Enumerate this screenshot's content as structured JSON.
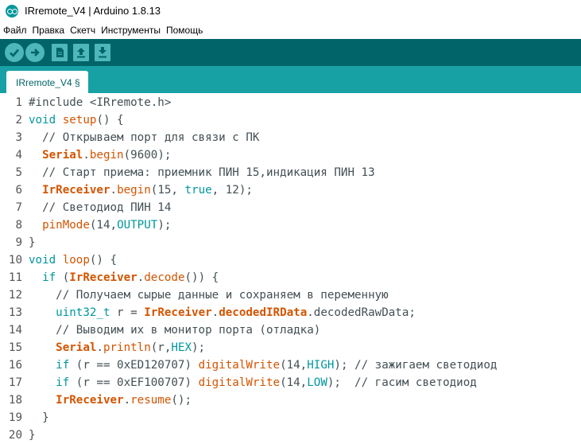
{
  "window": {
    "title": "IRremote_V4 | Arduino 1.8.13"
  },
  "menu": {
    "items": [
      "Файл",
      "Правка",
      "Скетч",
      "Инструменты",
      "Помощь"
    ]
  },
  "toolbar": {
    "buttons": [
      {
        "icon": "check-icon",
        "label": "verify"
      },
      {
        "icon": "arrow-right-icon",
        "label": "upload"
      },
      {
        "icon": "new-file-icon",
        "label": "new"
      },
      {
        "icon": "arrow-up-icon",
        "label": "open"
      },
      {
        "icon": "arrow-down-icon",
        "label": "save"
      }
    ]
  },
  "tabs": [
    {
      "label": "IRremote_V4 §"
    }
  ],
  "colors": {
    "toolbar": "#006468",
    "tabstrip": "#17a1a5",
    "keyword": "#00979c",
    "function": "#d35400",
    "text": "#434f54"
  },
  "editor": {
    "lines": [
      {
        "n": "1",
        "tokens": [
          {
            "t": "#include <IRremote.h>",
            "c": "plain"
          }
        ]
      },
      {
        "n": "2",
        "tokens": [
          {
            "t": "void",
            "c": "kw"
          },
          {
            "t": " ",
            "c": "plain"
          },
          {
            "t": "setup",
            "c": "fn"
          },
          {
            "t": "() {",
            "c": "plain"
          }
        ]
      },
      {
        "n": "3",
        "tokens": [
          {
            "t": "  // Открываем порт для связи с ПК",
            "c": "comment"
          }
        ]
      },
      {
        "n": "4",
        "tokens": [
          {
            "t": "  ",
            "c": "plain"
          },
          {
            "t": "Serial",
            "c": "bold"
          },
          {
            "t": ".",
            "c": "plain"
          },
          {
            "t": "begin",
            "c": "fn"
          },
          {
            "t": "(9600);",
            "c": "plain"
          }
        ]
      },
      {
        "n": "5",
        "tokens": [
          {
            "t": "  // Старт приема: приемник ПИН 15,индикация ПИН 13",
            "c": "comment"
          }
        ]
      },
      {
        "n": "6",
        "tokens": [
          {
            "t": "  ",
            "c": "plain"
          },
          {
            "t": "IrReceiver",
            "c": "bold"
          },
          {
            "t": ".",
            "c": "plain"
          },
          {
            "t": "begin",
            "c": "fn"
          },
          {
            "t": "(15, ",
            "c": "plain"
          },
          {
            "t": "true",
            "c": "const"
          },
          {
            "t": ", 12);",
            "c": "plain"
          }
        ]
      },
      {
        "n": "7",
        "tokens": [
          {
            "t": "  // Светодиод ПИН 14",
            "c": "comment"
          }
        ]
      },
      {
        "n": "8",
        "tokens": [
          {
            "t": "  ",
            "c": "plain"
          },
          {
            "t": "pinMode",
            "c": "fn"
          },
          {
            "t": "(14,",
            "c": "plain"
          },
          {
            "t": "OUTPUT",
            "c": "const"
          },
          {
            "t": ");",
            "c": "plain"
          }
        ]
      },
      {
        "n": "9",
        "tokens": [
          {
            "t": "}",
            "c": "plain"
          }
        ]
      },
      {
        "n": "10",
        "tokens": [
          {
            "t": "void",
            "c": "kw"
          },
          {
            "t": " ",
            "c": "plain"
          },
          {
            "t": "loop",
            "c": "fn"
          },
          {
            "t": "() {",
            "c": "plain"
          }
        ]
      },
      {
        "n": "11",
        "tokens": [
          {
            "t": "  ",
            "c": "plain"
          },
          {
            "t": "if",
            "c": "kw"
          },
          {
            "t": " (",
            "c": "plain"
          },
          {
            "t": "IrReceiver",
            "c": "bold"
          },
          {
            "t": ".",
            "c": "plain"
          },
          {
            "t": "decode",
            "c": "fn"
          },
          {
            "t": "()) {",
            "c": "plain"
          }
        ]
      },
      {
        "n": "12",
        "tokens": [
          {
            "t": "    // Получаем сырые данные и сохраняем в переменную",
            "c": "comment"
          }
        ]
      },
      {
        "n": "13",
        "tokens": [
          {
            "t": "    ",
            "c": "plain"
          },
          {
            "t": "uint32_t",
            "c": "kw"
          },
          {
            "t": " r = ",
            "c": "plain"
          },
          {
            "t": "IrReceiver",
            "c": "bold"
          },
          {
            "t": ".",
            "c": "plain"
          },
          {
            "t": "decodedIRData",
            "c": "bold"
          },
          {
            "t": ".decodedRawData;",
            "c": "plain"
          }
        ]
      },
      {
        "n": "14",
        "tokens": [
          {
            "t": "    // Выводим их в монитор порта (отладка)",
            "c": "comment"
          }
        ]
      },
      {
        "n": "15",
        "tokens": [
          {
            "t": "    ",
            "c": "plain"
          },
          {
            "t": "Serial",
            "c": "bold"
          },
          {
            "t": ".",
            "c": "plain"
          },
          {
            "t": "println",
            "c": "fn"
          },
          {
            "t": "(r,",
            "c": "plain"
          },
          {
            "t": "HEX",
            "c": "const"
          },
          {
            "t": ");",
            "c": "plain"
          }
        ]
      },
      {
        "n": "16",
        "tokens": [
          {
            "t": "    ",
            "c": "plain"
          },
          {
            "t": "if",
            "c": "kw"
          },
          {
            "t": " (r == 0xED120707) ",
            "c": "plain"
          },
          {
            "t": "digitalWrite",
            "c": "fn"
          },
          {
            "t": "(14,",
            "c": "plain"
          },
          {
            "t": "HIGH",
            "c": "const"
          },
          {
            "t": "); // зажигаем светодиод",
            "c": "plain"
          }
        ]
      },
      {
        "n": "17",
        "tokens": [
          {
            "t": "    ",
            "c": "plain"
          },
          {
            "t": "if",
            "c": "kw"
          },
          {
            "t": " (r == 0xEF100707) ",
            "c": "plain"
          },
          {
            "t": "digitalWrite",
            "c": "fn"
          },
          {
            "t": "(14,",
            "c": "plain"
          },
          {
            "t": "LOW",
            "c": "const"
          },
          {
            "t": ");  // гасим светодиод",
            "c": "plain"
          }
        ]
      },
      {
        "n": "18",
        "tokens": [
          {
            "t": "    ",
            "c": "plain"
          },
          {
            "t": "IrReceiver",
            "c": "bold"
          },
          {
            "t": ".",
            "c": "plain"
          },
          {
            "t": "resume",
            "c": "fn"
          },
          {
            "t": "();",
            "c": "plain"
          }
        ]
      },
      {
        "n": "19",
        "tokens": [
          {
            "t": "  }",
            "c": "plain"
          }
        ]
      },
      {
        "n": "20",
        "tokens": [
          {
            "t": "}",
            "c": "plain"
          }
        ]
      }
    ]
  }
}
